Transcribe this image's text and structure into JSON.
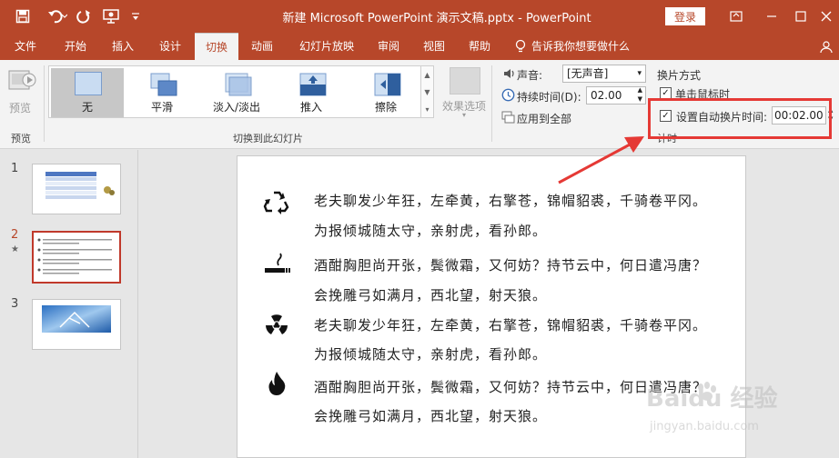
{
  "window": {
    "title": "新建 Microsoft PowerPoint 演示文稿.pptx  -  PowerPoint",
    "login_label": "登录"
  },
  "tabs": [
    "文件",
    "开始",
    "插入",
    "设计",
    "切换",
    "动画",
    "幻灯片放映",
    "审阅",
    "视图",
    "帮助"
  ],
  "tell_me": "告诉我你想要做什么",
  "ribbon": {
    "preview_label": "预览",
    "preview_group": "预览",
    "transitions": [
      "无",
      "平滑",
      "淡入/淡出",
      "推入",
      "擦除"
    ],
    "effect_options": "效果选项",
    "transitions_group": "切换到此幻灯片",
    "sound_label": "声音:",
    "sound_value": "[无声音]",
    "duration_label": "持续时间(D):",
    "duration_value": "02.00",
    "apply_all": "应用到全部",
    "advance_header": "换片方式",
    "on_click_label": "单击鼠标时",
    "auto_label": "设置自动换片时间:",
    "auto_value": "00:02.00",
    "timing_group": "计时"
  },
  "slides": {
    "numbers": [
      "1",
      "2",
      "3"
    ],
    "star": "★"
  },
  "poem": [
    {
      "icon": "recycle-icon",
      "lines": [
        "老夫聊发少年狂，左牵黄，右擎苍，锦帽貂裘，千骑卷平冈。",
        "为报倾城随太守，亲射虎，看孙郎。"
      ]
    },
    {
      "icon": "smoking-icon",
      "lines": [
        "酒酣胸胆尚开张，鬓微霜，又何妨？持节云中，何日遣冯唐？",
        "会挽雕弓如满月，西北望，射天狼。"
      ]
    },
    {
      "icon": "radioactive-icon",
      "lines": [
        "老夫聊发少年狂，左牵黄，右擎苍，锦帽貂裘，千骑卷平冈。",
        "为报倾城随太守，亲射虎，看孙郎。"
      ]
    },
    {
      "icon": "flame-icon",
      "lines": [
        "酒酣胸胆尚开张，鬓微霜，又何妨？持节云中，何日遣冯唐？",
        "会挽雕弓如满月，西北望，射天狼。"
      ]
    }
  ],
  "watermark": {
    "brand": "Baidu 经验",
    "url": "jingyan.baidu.com"
  },
  "colors": {
    "accent": "#b7472a",
    "highlight": "#e53935"
  }
}
